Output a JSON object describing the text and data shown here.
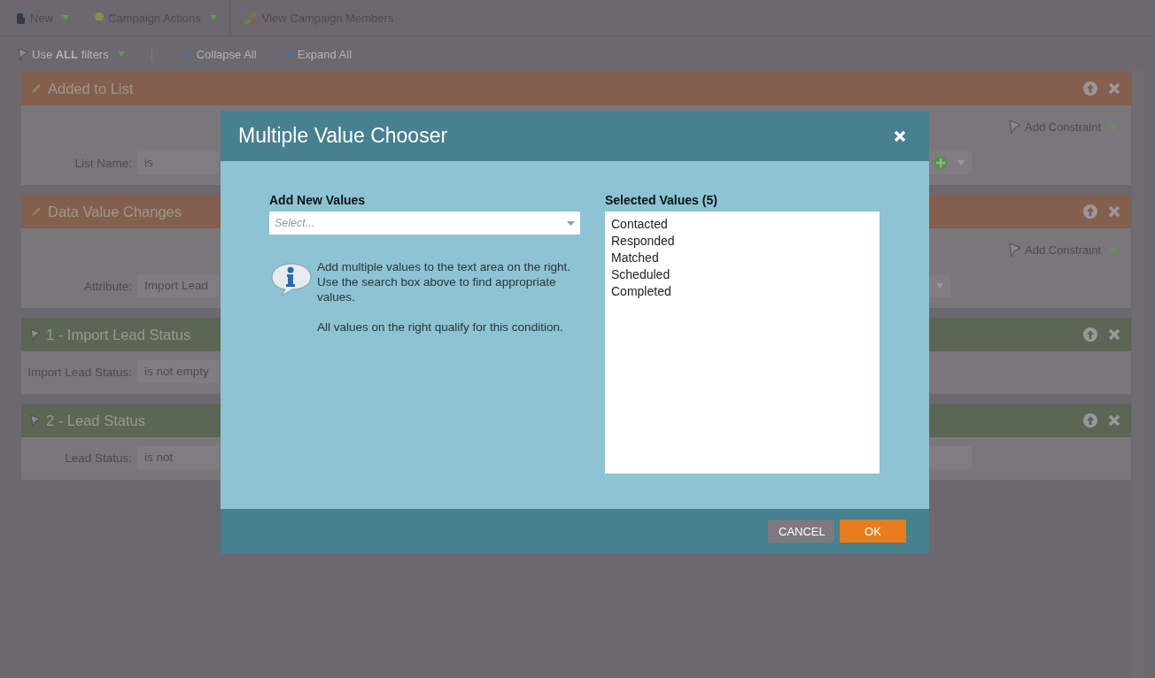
{
  "toolbar": [
    {
      "label": "New",
      "dropdown": true
    },
    {
      "label": "Campaign Actions",
      "dropdown": true
    },
    {
      "label": "View Campaign Members",
      "dropdown": false
    }
  ],
  "filter_bar": {
    "logic": "Use **ALL** filters",
    "collapse": "Collapse All",
    "expand": "Expand All"
  },
  "cards": [
    {
      "kind": "trigger",
      "title": "Added to List",
      "add_constraint": "Add Constraint",
      "label": "List Name:",
      "value": "is"
    },
    {
      "kind": "trigger",
      "title": "Data Value Changes",
      "add_constraint": "Add Constraint",
      "label": "Attribute:",
      "value": "Import Lead"
    },
    {
      "kind": "filter",
      "title": "1 - Import Lead Status",
      "label": "Import Lead Status:",
      "value": "is not empty"
    },
    {
      "kind": "filter",
      "title": "2 - Lead Status",
      "label": "Lead Status:",
      "value": "is not"
    }
  ],
  "dialog": {
    "title": "Multiple Value Chooser",
    "add_label": "Add New Values",
    "select_placeholder": "Select...",
    "info": "Add multiple values to the text area on the right. Use the search box above to find appropriate values.",
    "note": "All values on the right qualify for this condition.",
    "selected_label": "Selected Values (5)",
    "values": [
      "Contacted",
      "Responded",
      "Matched",
      "Scheduled",
      "Completed"
    ],
    "cancel": "CANCEL",
    "ok": "OK"
  }
}
